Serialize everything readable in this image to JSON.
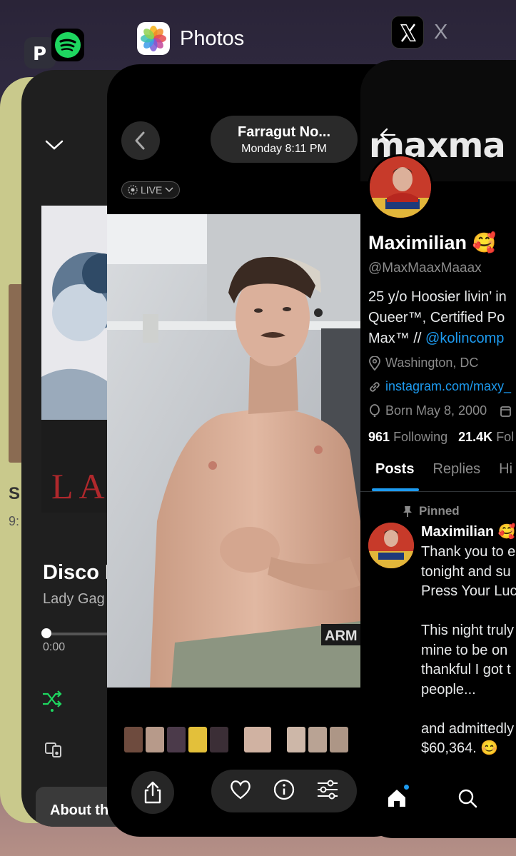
{
  "switcher": {
    "spotify_app": {
      "icon": "spotify-icon",
      "label": ""
    },
    "photos_app": {
      "icon": "photos-icon",
      "label": "Photos"
    },
    "x_app": {
      "icon": "x-icon",
      "label": "X"
    }
  },
  "spotify": {
    "track_title": "Disco H",
    "artist": "Lady Gag",
    "elapsed": "0:00",
    "about_label": "About th",
    "album_text": "LA",
    "side_letter": "S",
    "side_number": "9:"
  },
  "photos": {
    "title": "Farragut No...",
    "subtitle": "Monday  8:11 PM",
    "live_badge": "LIVE",
    "underwear_text": "ARM"
  },
  "x": {
    "banner_text": "maxma",
    "display_name": "Maximilian 🥰",
    "handle": "@MaxMaaxMaaax",
    "bio_line1": "25 y/o Hoosier livin’ in",
    "bio_line2": "Queer™, Certified Po",
    "bio_line3_prefix": "Max™ // ",
    "bio_line3_link": "@kolincomp",
    "location": "Washington, DC",
    "website": "instagram.com/maxy_",
    "birthday": "Born May 8, 2000",
    "following_count": "961",
    "following_label": "Following",
    "followers_count": "21.4K",
    "followers_label": "Fol",
    "tabs": [
      "Posts",
      "Replies",
      "Hi"
    ],
    "pinned_label": "Pinned",
    "tweet_name": "Maximilian 🥰",
    "tweet_body": "Thank you to e\ntonight and su\nPress Your Luc\n\nThis night truly\nmine to be on\nthankful I got t\npeople...\n\nand admittedly\n$60,364. 😊",
    "colors": {
      "link": "#1d9bf0"
    }
  }
}
